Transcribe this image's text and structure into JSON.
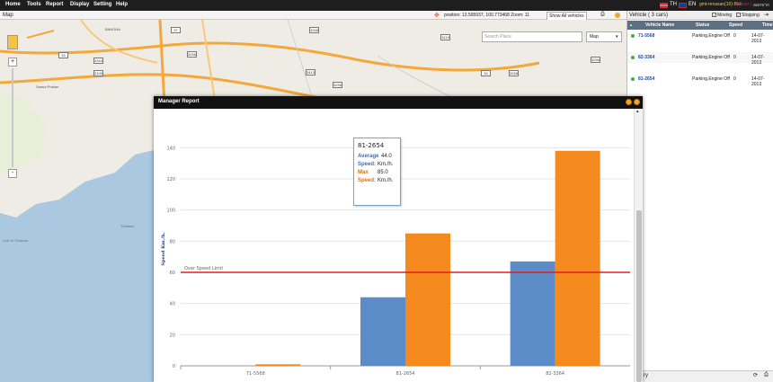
{
  "menu": {
    "items": [
      "Home",
      "Tools",
      "Report",
      "Display",
      "Setting",
      "Help"
    ],
    "lang_th": "TH",
    "lang_en": "EN",
    "user_text": "gmt-renasan(10)-Bkk",
    "user_suffix": " | User |",
    "logout": "ออกจากระบบ"
  },
  "map": {
    "title": "Map",
    "position_text": "position: 13.595937, 100.773468 Zoom: 11",
    "show_all_label": "Show All vehicles",
    "search_placeholder": "Search Place",
    "maptype": "Map",
    "zoom_in": "+",
    "zoom_out": "-",
    "place_labels": [
      "BANGNA",
      "Samut Prakan",
      "Thailand",
      "Gulf of Thailand"
    ],
    "road_badges": [
      "34",
      "3344",
      "37",
      "3256",
      "3100",
      "3268",
      "3413",
      "3256",
      "3119",
      "34",
      "3268",
      "3256"
    ]
  },
  "vehicles": {
    "title": "Vehicle ( 3 cars)",
    "moving_label": "Moving",
    "stopping_label": "Stopping",
    "columns": [
      "",
      "Vehicle Name",
      "Status",
      "Speed",
      "Time"
    ],
    "rows": [
      {
        "name": "71-5568",
        "status": "Parking,Engine Off",
        "speed": "0",
        "time": "14-07-2013"
      },
      {
        "name": "82-3364",
        "status": "Parking,Engine Off",
        "speed": "0",
        "time": "14-07-2013"
      },
      {
        "name": "81-2654",
        "status": "Parking,Engine Off",
        "speed": "0",
        "time": "14-07-2013"
      }
    ],
    "bottom_label": "ry"
  },
  "report": {
    "title": "Manager Report"
  },
  "tooltip": {
    "vehicle": "81-2654",
    "avg_label_1": "Average",
    "avg_value": "44.0",
    "avg_label_2": "Speed:",
    "avg_unit": "Km./h.",
    "max_label_1": "Max",
    "max_value": "85.0",
    "max_label_2": "Speed:",
    "max_unit": "Km./h."
  },
  "colors": {
    "average": "#5b8cc8",
    "max": "#f58a1f",
    "limit_line": "#e02020",
    "topbar": "#1e1e1e",
    "vehicle_link": "#1a4fb5"
  },
  "chart_data": {
    "type": "bar",
    "categories": [
      "71-5568",
      "81-2654",
      "82-3364"
    ],
    "series": [
      {
        "name": "Average Speed",
        "values": [
          0,
          44.0,
          67
        ]
      },
      {
        "name": "Max Speed",
        "values": [
          1,
          85.0,
          138
        ]
      }
    ],
    "ylabel": "Speed Km./h.",
    "ylim": [
      0,
      150
    ],
    "yticks": [
      0,
      20,
      40,
      60,
      80,
      100,
      120,
      140
    ],
    "threshold": {
      "label": "Over Speed Limit",
      "value": 60
    },
    "grid": true
  }
}
